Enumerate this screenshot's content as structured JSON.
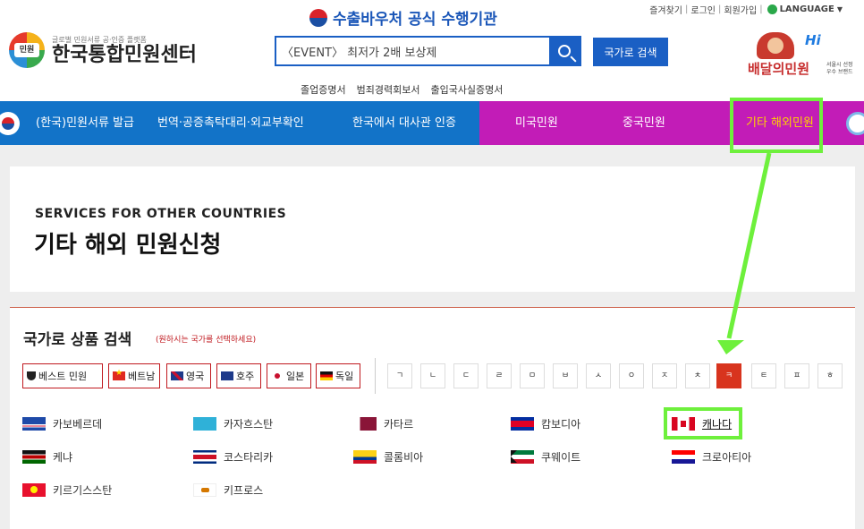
{
  "top_links": {
    "bookmark": "즐겨찾기",
    "login": "로그인",
    "signup": "회원가입",
    "language": "LANGUAGE"
  },
  "voucher_banner": "수출바우처 공식 수행기관",
  "logo": {
    "sub": "글로벌 민원서류 공·인증 플랫폼",
    "badge": "민원",
    "name": "한국통합민원센터"
  },
  "search": {
    "value": "〈EVENT〉 최저가 2배 보상제",
    "country_search_label": "국가로 검색"
  },
  "quick_links": [
    "졸업증명서",
    "범죄경력회보서",
    "출입국사실증명서"
  ],
  "brand": {
    "hi": "Hi",
    "name": "배달의민원",
    "note1": "서울시 선정",
    "note2": "우수 브랜드"
  },
  "nav": {
    "items": [
      "(한국)민원서류 발급",
      "번역·공증촉탁대리·외교부확인",
      "한국에서 대사관 인증",
      "미국민원",
      "중국민원",
      "기타 해외민원"
    ]
  },
  "page_title": {
    "en": "SERVICES FOR OTHER COUNTRIES",
    "ko": "기타 해외 민원신청"
  },
  "country_search": {
    "title": "국가로 상품 검색",
    "hint": "(원하시는 국가를 선택하세요)",
    "chips": [
      "베스트 민원",
      "베트남",
      "영국",
      "호주",
      "일본",
      "독일"
    ],
    "consonants": [
      "ㄱ",
      "ㄴ",
      "ㄷ",
      "ㄹ",
      "ㅁ",
      "ㅂ",
      "ㅅ",
      "ㅇ",
      "ㅈ",
      "ㅊ",
      "ㅋ",
      "ㅌ",
      "ㅍ",
      "ㅎ"
    ],
    "active_consonant": "ㅋ",
    "countries": [
      "카보베르데",
      "카자흐스탄",
      "카타르",
      "캄보디아",
      "캐나다",
      "케냐",
      "코스타리카",
      "콜롬비아",
      "쿠웨이트",
      "크로아티아",
      "키르기스스탄",
      "키프로스"
    ],
    "selected_country": "캐나다"
  },
  "colors": {
    "nav_blue": "#1273c8",
    "nav_magenta": "#c21cb7",
    "highlight_green": "#6ef03c",
    "active_consonant": "#d8341e",
    "accent_red": "#c0191f"
  }
}
